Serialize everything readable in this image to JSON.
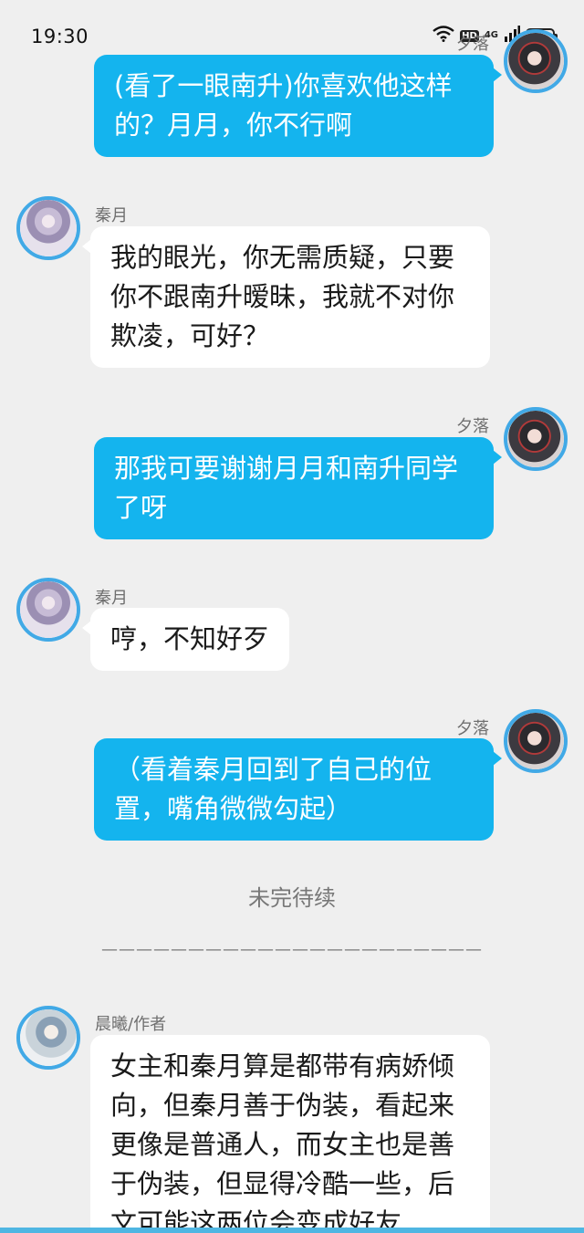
{
  "status_bar": {
    "time": "19:30",
    "hd_label": "HD",
    "network": "4G",
    "battery": "74",
    "icons": [
      "wifi-icon",
      "hd-icon",
      "signal-icon",
      "battery-icon"
    ]
  },
  "messages": [
    {
      "side": "right",
      "sender": "夕落",
      "avatar": "avatar-xi-luo",
      "text": "(看了一眼南升)你喜欢他这样的？月月，你不行啊"
    },
    {
      "side": "left",
      "sender": "秦月",
      "avatar": "avatar-qin-yue",
      "text": "我的眼光，你无需质疑，只要你不跟南升暧昧，我就不对你欺凌，可好？"
    },
    {
      "side": "right",
      "sender": "夕落",
      "avatar": "avatar-xi-luo",
      "text": "那我可要谢谢月月和南升同学了呀"
    },
    {
      "side": "left",
      "sender": "秦月",
      "avatar": "avatar-qin-yue",
      "text": "哼，不知好歹"
    },
    {
      "side": "right",
      "sender": "夕落",
      "avatar": "avatar-xi-luo",
      "text": "（看着秦月回到了自己的位置，嘴角微微勾起）"
    },
    {
      "side": "left",
      "sender": "晨曦/作者",
      "avatar": "avatar-chen-xi",
      "text": "女主和秦月算是都带有病娇倾向，但秦月善于伪装，看起来更像是普通人，而女主也是善于伪装，但显得冷酷一些，后文可能这两位会变成好友"
    }
  ],
  "notes": {
    "to_be_continued": "未完待续",
    "divider": "——————————————————————"
  },
  "colors": {
    "background": "#efefef",
    "outgoing_bubble": "#14b4ee",
    "incoming_bubble": "#ffffff",
    "avatar_ring": "#41a9e6"
  }
}
